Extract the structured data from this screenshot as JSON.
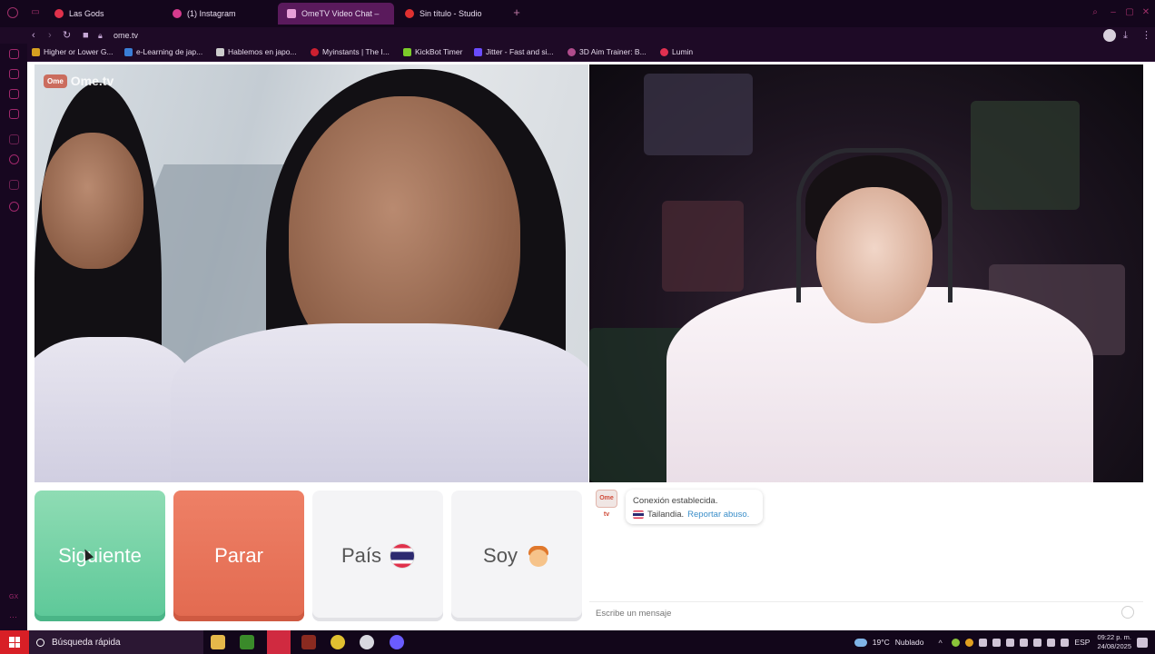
{
  "browser": {
    "tabs": [
      {
        "label": "Las Gods",
        "color": "#e0314b",
        "active": false
      },
      {
        "label": "(1) Instagram",
        "color": "#d63b8e",
        "active": false
      },
      {
        "label": "OmeTV Video Chat –",
        "color": "#c03b9a",
        "active": true
      },
      {
        "label": "Sin título - Studio",
        "color": "#e03030",
        "active": false
      }
    ],
    "new_tab": "+",
    "url": "ome.tv",
    "bookmarks": [
      {
        "label": "Higher or Lower G...",
        "color": "#d6a020"
      },
      {
        "label": "e-Learning de jap...",
        "color": "#3a7ed6"
      },
      {
        "label": "Hablemos en japo...",
        "color": "#cccccc"
      },
      {
        "label": "Myinstants | The I...",
        "color": "#cc2030"
      },
      {
        "label": "KickBot Timer",
        "color": "#7ccc2a"
      },
      {
        "label": "Jitter - Fast and si...",
        "color": "#6a4cff"
      },
      {
        "label": "3D Aim Trainer: B...",
        "color": "#b04c8c"
      },
      {
        "label": "Lumin",
        "color": "#e03050"
      }
    ]
  },
  "video": {
    "logo_badge": "Ome",
    "logo_text": "Ome.tv"
  },
  "controls": {
    "next_label": "Siguiente",
    "stop_label": "Parar",
    "country_label": "País",
    "iam_label": "Soy"
  },
  "chat": {
    "avatar_label": "Ome tv",
    "connection_text": "Conexión establecida.",
    "country_text": "Tailandia.",
    "report_text": "Reportar abuso.",
    "input_placeholder": "Escribe un mensaje"
  },
  "taskbar": {
    "search_label": "Búsqueda rápida",
    "temperature": "19°C",
    "weather": "Nublado",
    "language": "ESP",
    "time": "09:22 p. m.",
    "date": "24/08/2025"
  }
}
